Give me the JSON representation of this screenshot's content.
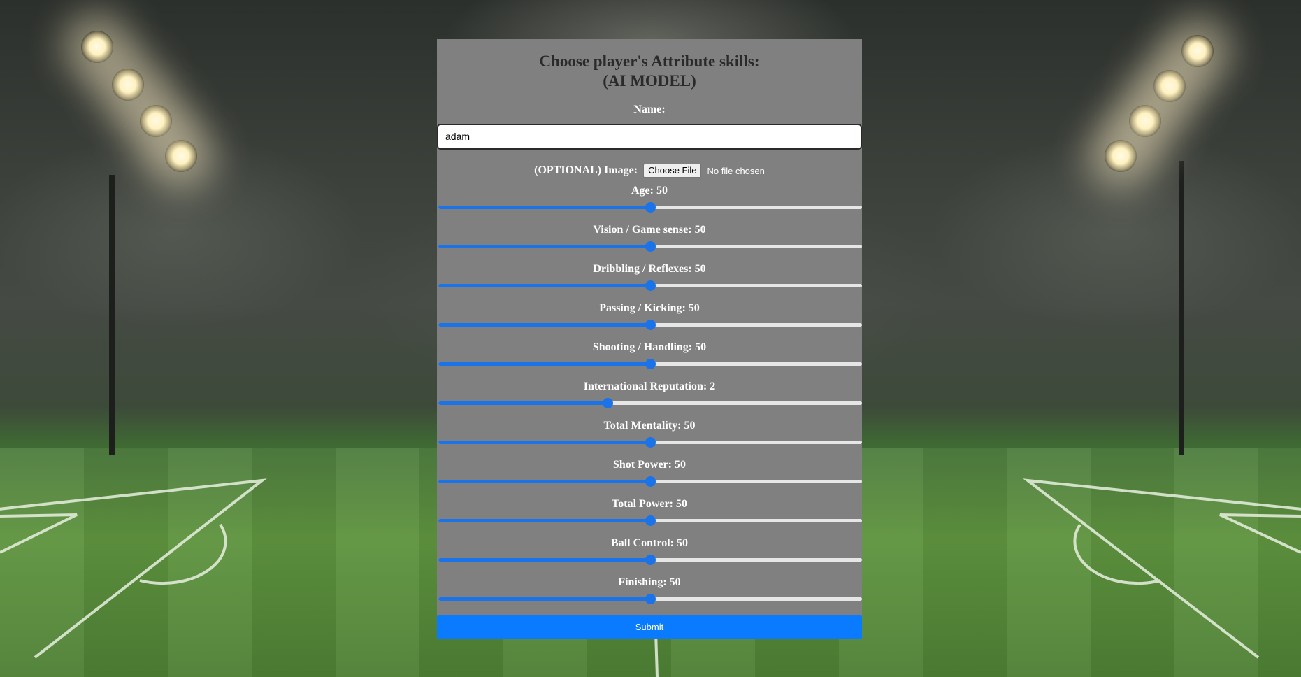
{
  "form": {
    "title_line1": "Choose player's Attribute skills:",
    "title_line2": "(AI MODEL)",
    "name_label": "Name:",
    "name_value": "adam",
    "image_label": "(OPTIONAL) Image:",
    "file_button_label": "Choose File",
    "file_status": "No file chosen",
    "submit_label": "Submit"
  },
  "sliders": [
    {
      "label": "Age: 50",
      "fraction": 0.5
    },
    {
      "label": "Vision / Game sense: 50",
      "fraction": 0.5
    },
    {
      "label": "Dribbling / Reflexes: 50",
      "fraction": 0.5
    },
    {
      "label": "Passing / Kicking: 50",
      "fraction": 0.5
    },
    {
      "label": "Shooting / Handling: 50",
      "fraction": 0.5
    },
    {
      "label": "International Reputation: 2",
      "fraction": 0.4
    },
    {
      "label": "Total Mentality: 50",
      "fraction": 0.5
    },
    {
      "label": "Shot Power: 50",
      "fraction": 0.5
    },
    {
      "label": "Total Power: 50",
      "fraction": 0.5
    },
    {
      "label": "Ball Control: 50",
      "fraction": 0.5
    },
    {
      "label": "Finishing: 50",
      "fraction": 0.5
    }
  ],
  "colors": {
    "slider_accent": "#1a73e8",
    "submit_background": "#0a7bfe",
    "card_background": "#808080"
  }
}
